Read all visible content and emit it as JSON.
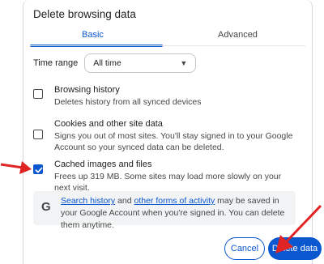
{
  "dialog": {
    "title": "Delete browsing data",
    "tabs": [
      {
        "label": "Basic",
        "selected": true
      },
      {
        "label": "Advanced",
        "selected": false
      }
    ],
    "time_range": {
      "label": "Time range",
      "selected": "All time"
    },
    "items": [
      {
        "title": "Browsing history",
        "description": "Deletes history from all synced devices",
        "checked": false
      },
      {
        "title": "Cookies and other site data",
        "description": "Signs you out of most sites. You'll stay signed in to your Google Account so your synced data can be deleted.",
        "checked": false
      },
      {
        "title": "Cached images and files",
        "description": "Frees up 319 MB. Some sites may load more slowly on your next visit.",
        "checked": true
      }
    ],
    "info": {
      "icon": "G",
      "link1": "Search history",
      "text_mid": " and ",
      "link2": "other forms of activity",
      "text_end": " may be saved in your Google Account when you're signed in. You can delete them anytime."
    },
    "buttons": {
      "cancel": "Cancel",
      "delete": "Delete data"
    }
  },
  "annotations": {
    "arrow_color": "#e02424"
  }
}
